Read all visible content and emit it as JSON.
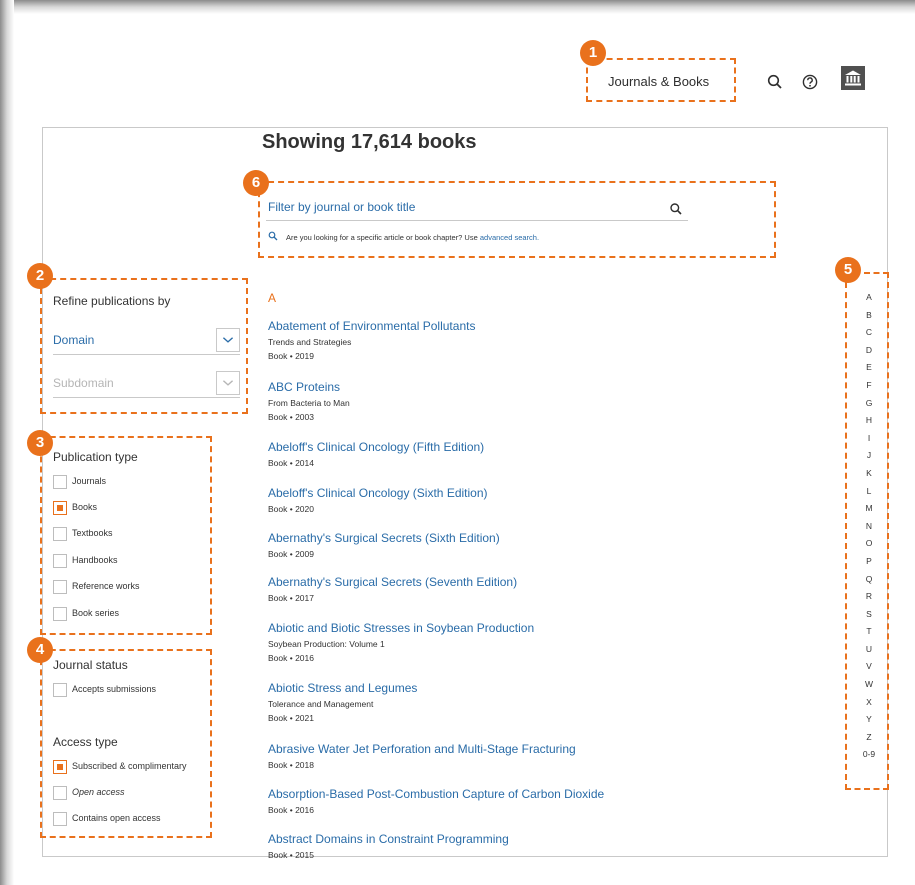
{
  "header": {
    "nav_link": "Journals & Books",
    "icons": [
      "search-icon",
      "help-icon",
      "institution-icon"
    ]
  },
  "heading": "Showing 17,614 books",
  "search": {
    "placeholder": "Filter by journal or book title",
    "hint_text": "Are you looking for a specific article or book chapter? Use",
    "hint_link": "advanced search."
  },
  "refine": {
    "title": "Refine publications by",
    "domain_label": "Domain",
    "subdomain_label": "Subdomain"
  },
  "publication_type": {
    "title": "Publication type",
    "options": [
      {
        "label": "Journals",
        "checked": false
      },
      {
        "label": "Books",
        "checked": true
      },
      {
        "label": "Textbooks",
        "checked": false
      },
      {
        "label": "Handbooks",
        "checked": false
      },
      {
        "label": "Reference works",
        "checked": false
      },
      {
        "label": "Book series",
        "checked": false
      }
    ]
  },
  "journal_status": {
    "title": "Journal status",
    "options": [
      {
        "label": "Accepts submissions",
        "checked": false
      }
    ]
  },
  "access_type": {
    "title": "Access type",
    "options": [
      {
        "label": "Subscribed & complimentary",
        "checked": true
      },
      {
        "label": "Open access",
        "checked": false
      },
      {
        "label": "Contains open access",
        "checked": false
      }
    ]
  },
  "results": {
    "letter": "A",
    "books": [
      {
        "title": "Abatement of Environmental Pollutants",
        "subtitle": "Trends and Strategies",
        "meta": "Book • 2019"
      },
      {
        "title": "ABC Proteins",
        "subtitle": "From Bacteria to Man",
        "meta": "Book • 2003"
      },
      {
        "title": "Abeloff's Clinical Oncology (Fifth Edition)",
        "subtitle": "",
        "meta": "Book • 2014"
      },
      {
        "title": "Abeloff's Clinical Oncology (Sixth Edition)",
        "subtitle": "",
        "meta": "Book • 2020"
      },
      {
        "title": "Abernathy's Surgical Secrets (Sixth Edition)",
        "subtitle": "",
        "meta": "Book • 2009"
      },
      {
        "title": "Abernathy's Surgical Secrets (Seventh Edition)",
        "subtitle": "",
        "meta": "Book • 2017"
      },
      {
        "title": "Abiotic and Biotic Stresses in Soybean Production",
        "subtitle": "Soybean Production: Volume 1",
        "meta": "Book • 2016"
      },
      {
        "title": "Abiotic Stress and Legumes",
        "subtitle": "Tolerance and Management",
        "meta": "Book • 2021"
      },
      {
        "title": "Abrasive Water Jet Perforation and Multi-Stage Fracturing",
        "subtitle": "",
        "meta": "Book • 2018"
      },
      {
        "title": "Absorption-Based Post-Combustion Capture of Carbon Dioxide",
        "subtitle": "",
        "meta": "Book • 2016"
      },
      {
        "title": "Abstract Domains in Constraint Programming",
        "subtitle": "",
        "meta": "Book • 2015"
      }
    ]
  },
  "alphabet": [
    "A",
    "B",
    "C",
    "D",
    "E",
    "F",
    "G",
    "H",
    "I",
    "J",
    "K",
    "L",
    "M",
    "N",
    "O",
    "P",
    "Q",
    "R",
    "S",
    "T",
    "U",
    "V",
    "W",
    "X",
    "Y",
    "Z",
    "0-9"
  ],
  "callouts": [
    "1",
    "2",
    "3",
    "4",
    "5",
    "6"
  ],
  "colors": {
    "accent": "#e9711c",
    "link": "#2a6ca8",
    "border": "#c9c9c9"
  }
}
